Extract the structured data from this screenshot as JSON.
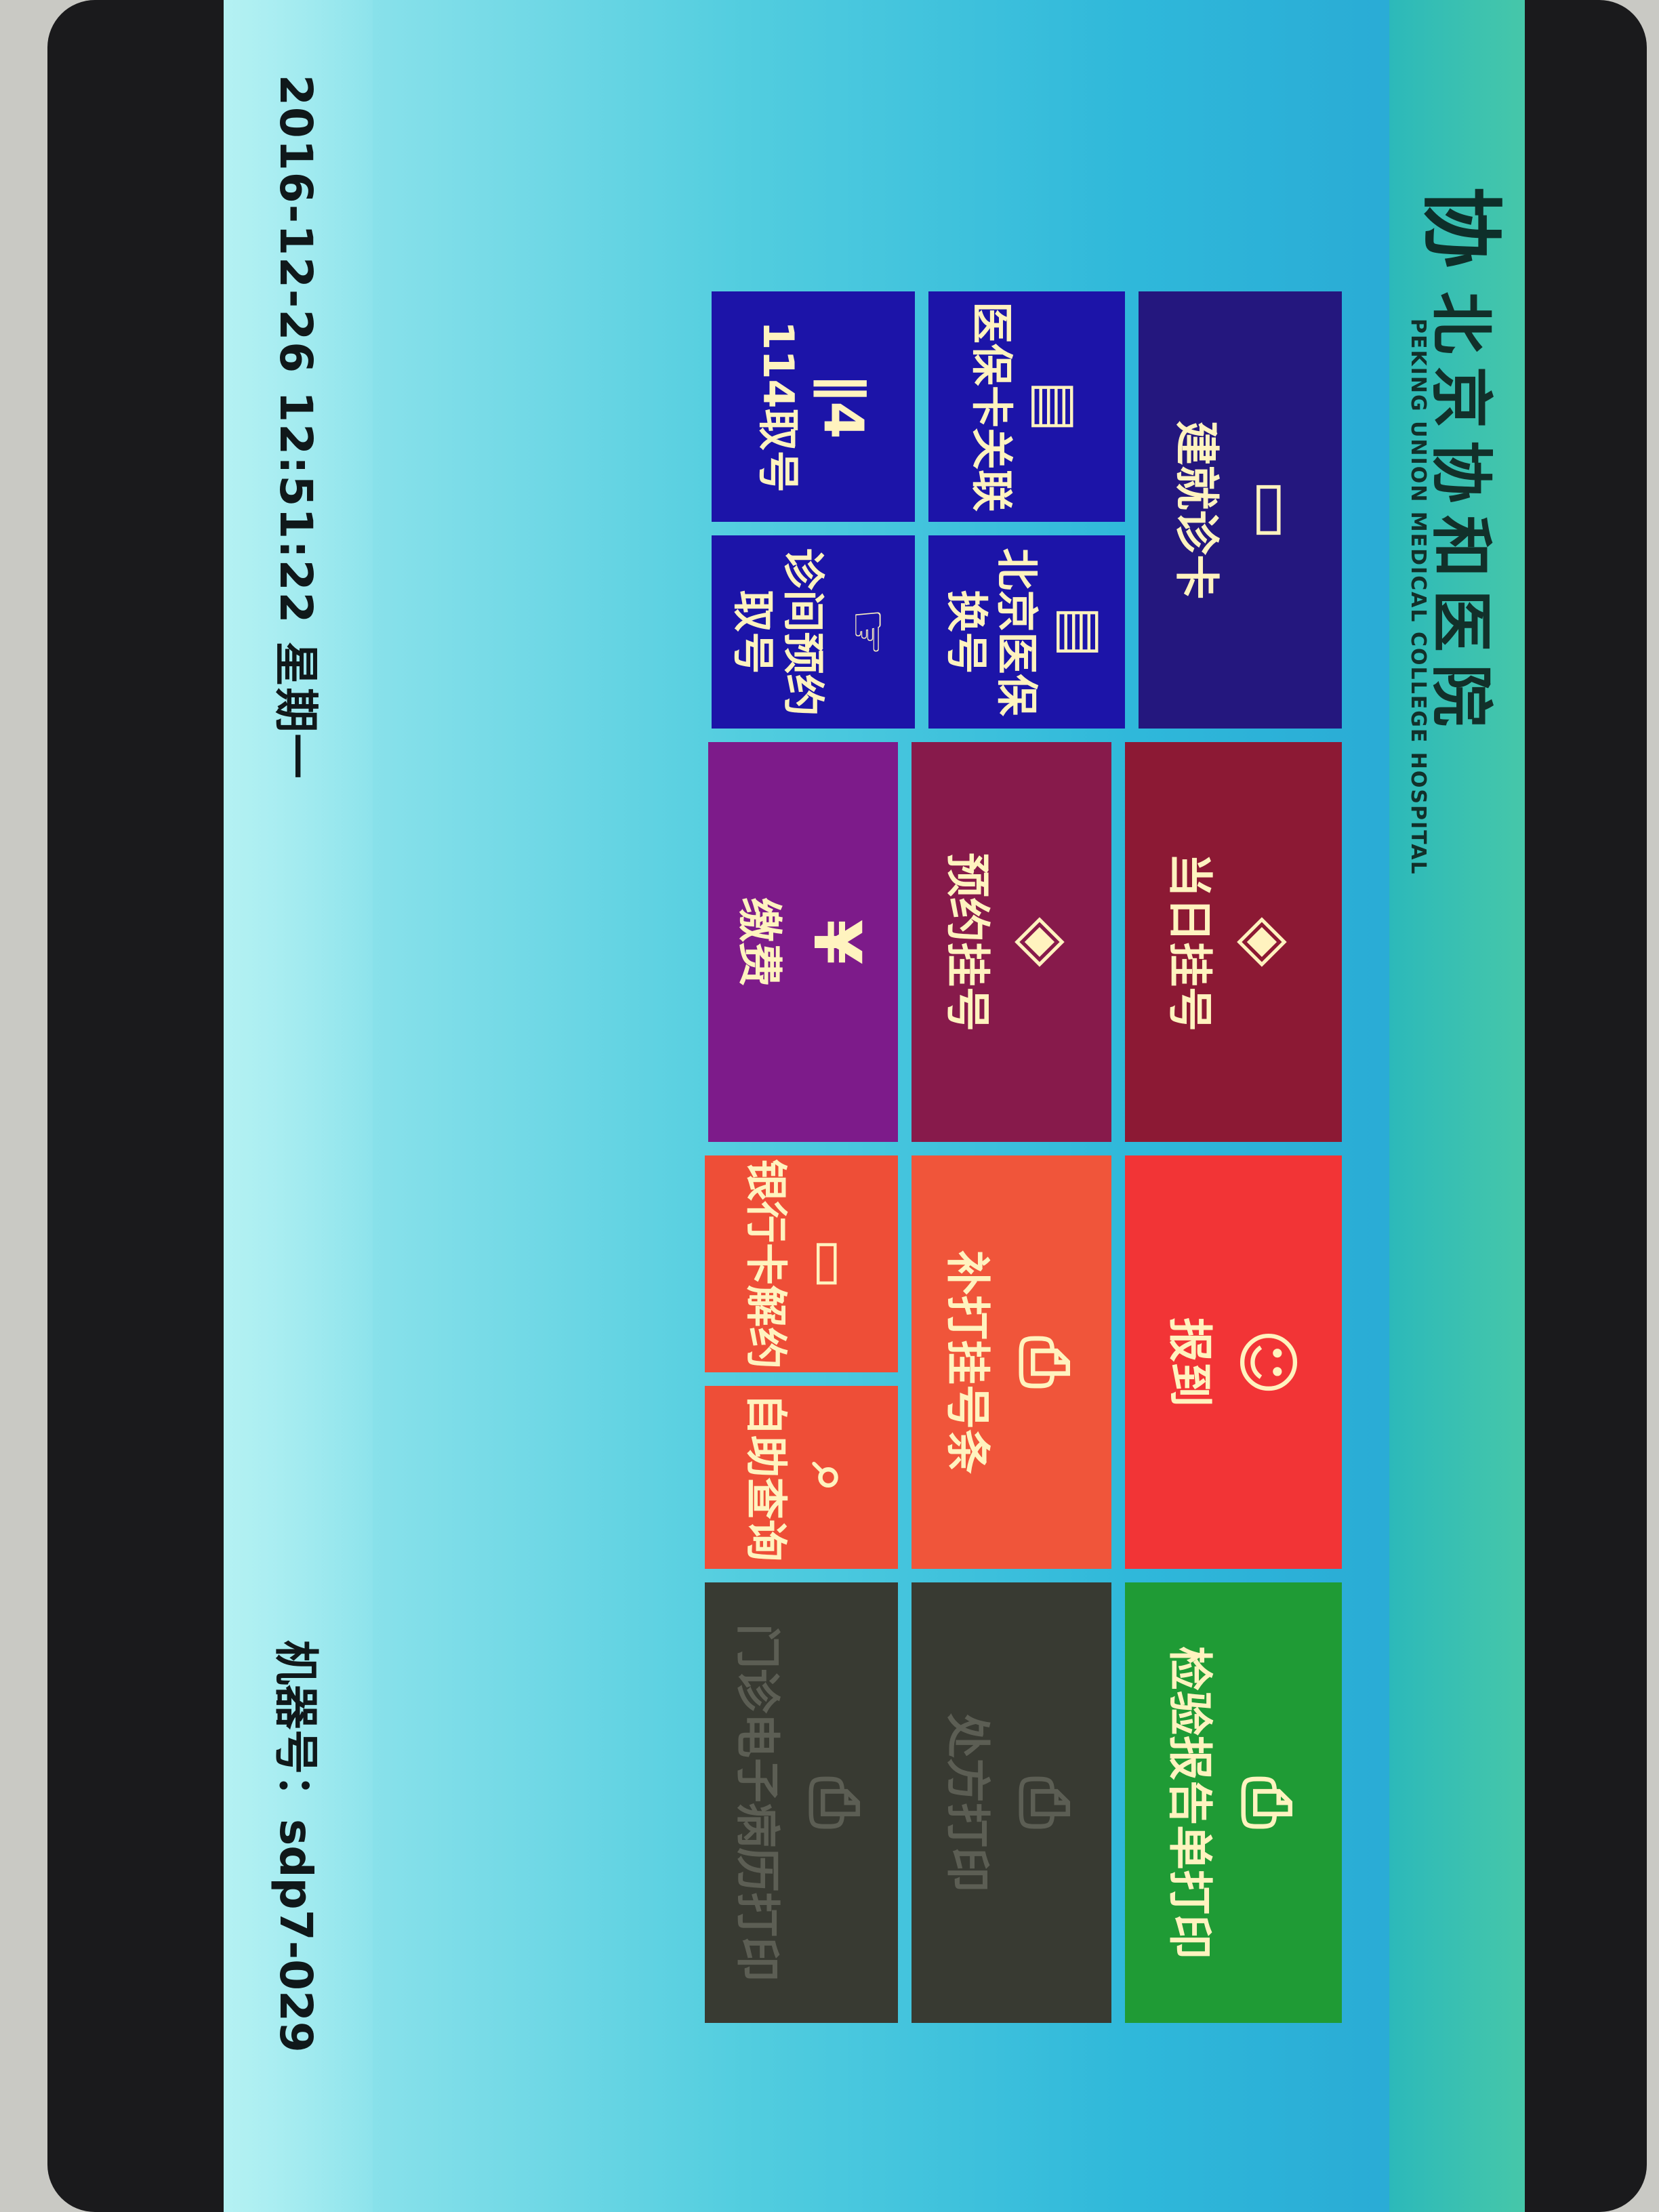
{
  "header": {
    "logo_mark": "协",
    "hospital_name_cn": "北京协和医院",
    "hospital_name_en": "PEKING UNION MEDICAL COLLEGE HOSPITAL"
  },
  "tiles": [
    {
      "label": "建就诊卡",
      "icon": "card-icon",
      "glyph": "▭",
      "color": "#24177e"
    },
    {
      "label": "医保卡关联",
      "icon": "id-card-icon",
      "glyph": "▤",
      "color": "#1c14a8"
    },
    {
      "label": "北京医保换号",
      "icon": "id-card-icon",
      "glyph": "▤",
      "color": "#1c14a8"
    },
    {
      "label": "114取号",
      "icon": "phone-114-icon",
      "glyph": "∥4",
      "color": "#1c14a8"
    },
    {
      "label": "诊间预约取号",
      "icon": "hand-card-icon",
      "glyph": "☞",
      "color": "#1c14a8"
    },
    {
      "label": "当日挂号",
      "icon": "hand-ticket-icon",
      "glyph": "◈",
      "color": "#8c1934"
    },
    {
      "label": "预约挂号",
      "icon": "hand-ticket-icon",
      "glyph": "◈",
      "color": "#871a4b"
    },
    {
      "label": "缴费",
      "icon": "payment-icon",
      "glyph": "¥",
      "color": "#7d1b8a"
    },
    {
      "label": "报到",
      "icon": "smile-icon",
      "glyph": "☺",
      "color": "#f23436"
    },
    {
      "label": "补打挂号条",
      "icon": "printer-ticket-icon",
      "glyph": "⎙",
      "color": "#f0553a"
    },
    {
      "label": "银行卡解约",
      "icon": "bank-card-icon",
      "glyph": "▭",
      "color": "#ee4e37"
    },
    {
      "label": "自助查询",
      "icon": "search-icon",
      "glyph": "⌕",
      "color": "#ee4e37"
    },
    {
      "label": "检验报告单打印",
      "icon": "printer-icon",
      "glyph": "⎙",
      "color": "#1f9b35"
    },
    {
      "label": "处方打印",
      "icon": "printer-icon",
      "glyph": "⎙",
      "color": "#383a32"
    },
    {
      "label": "门诊电子病历打印",
      "icon": "printer-icon",
      "glyph": "⎙",
      "color": "#383a32"
    }
  ],
  "footer": {
    "datetime": "2016-12-26 12:51:22 星期一",
    "machine_label": "机器号：sdp7-029"
  }
}
